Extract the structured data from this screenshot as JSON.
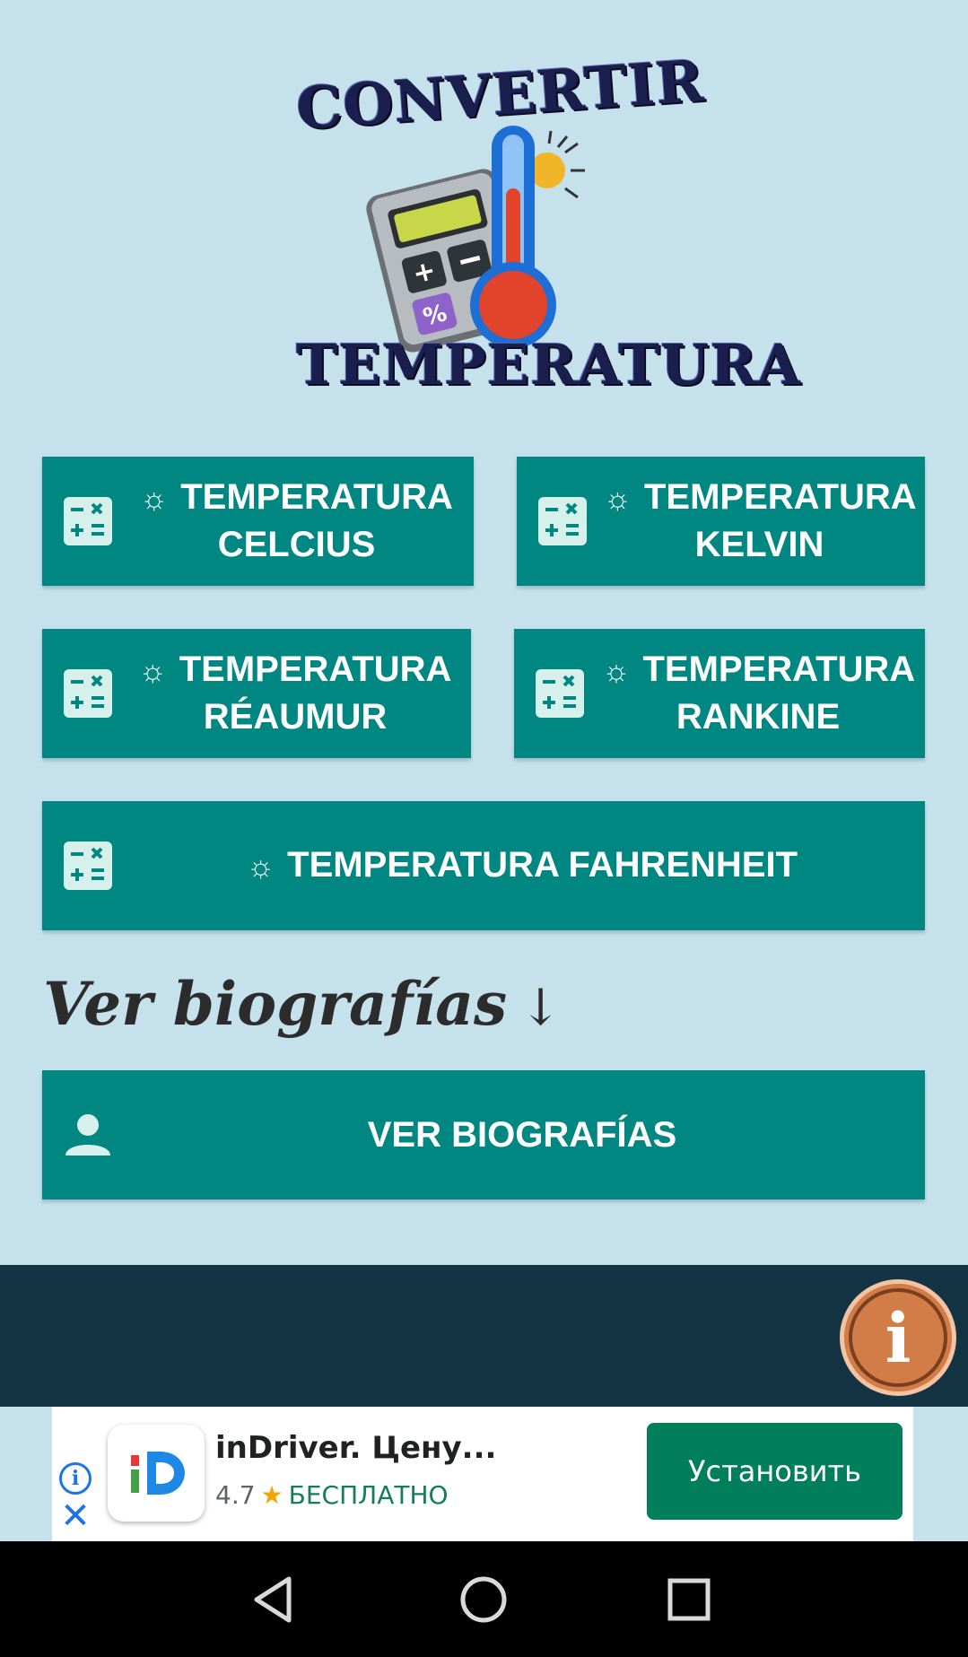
{
  "logo": {
    "top_text": "CONVERTIR",
    "bottom_text": "TEMPERATURA"
  },
  "buttons": {
    "celcius": {
      "sun": "☼",
      "label": "TEMPERATURA CELCIUS",
      "icon": "calculator-icon"
    },
    "kelvin": {
      "sun": "☼",
      "label": "TEMPERATURA KELVIN",
      "icon": "calculator-icon"
    },
    "reaumur": {
      "sun": "☼",
      "label": "TEMPERATURA RÉAUMUR",
      "icon": "calculator-icon"
    },
    "rankine": {
      "sun": "☼",
      "label": "TEMPERATURA RANKINE",
      "icon": "calculator-icon"
    },
    "fahrenheit": {
      "sun": "☼",
      "label": "TEMPERATURA FAHRENHEIT",
      "icon": "calculator-icon"
    }
  },
  "bios": {
    "heading": "Ver biografías",
    "arrow": "↓",
    "button_label": "VER BIOGRAFÍAS",
    "icon": "person-icon"
  },
  "info_fab": {
    "glyph": "i"
  },
  "ad": {
    "title": "inDriver. Цену...",
    "rating": "4.7",
    "star": "★",
    "price": "БЕСПЛАТНО",
    "install_label": "Установить",
    "info_glyph": "i",
    "close_glyph": "✕"
  },
  "colors": {
    "background": "#c5e1ec",
    "button": "#008781",
    "dark_band": "#143443",
    "info_fab": "#d27c48",
    "install": "#017e5a"
  }
}
